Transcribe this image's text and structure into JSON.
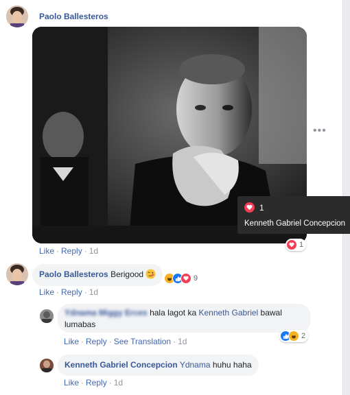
{
  "post": {
    "author": "Paolo Ballesteros",
    "reaction_tooltip": {
      "count": "1",
      "names": "Kenneth Gabriel Concepcion"
    },
    "reaction_count": "1",
    "actions": {
      "like": "Like",
      "reply": "Reply",
      "time": "1d"
    }
  },
  "comment1": {
    "author": "Paolo Ballesteros",
    "text": "Berigood",
    "reaction_count": "9",
    "actions": {
      "like": "Like",
      "reply": "Reply",
      "time": "1d"
    }
  },
  "reply1": {
    "author": "Ydnama Miggy Erces",
    "text_before": "hala lagot ka",
    "mention": "Kenneth Gabriel",
    "text_after": "bawal",
    "line2": "lumabas",
    "reaction_count": "2",
    "actions": {
      "like": "Like",
      "reply": "Reply",
      "see_translation": "See Translation",
      "time": "1d"
    }
  },
  "reply2": {
    "author": "Kenneth Gabriel Concepcion",
    "mention": "Ydnama",
    "text": "huhu haha",
    "actions": {
      "like": "Like",
      "reply": "Reply",
      "time": "1d"
    }
  },
  "colors": {
    "link": "#385898",
    "action_link": "#4267b2",
    "love": "#f33e58",
    "like": "#1877f2",
    "haha": "#f7b125"
  },
  "icons": [
    "love-icon",
    "like-icon",
    "haha-icon",
    "more-icon",
    "wink-emoji"
  ]
}
